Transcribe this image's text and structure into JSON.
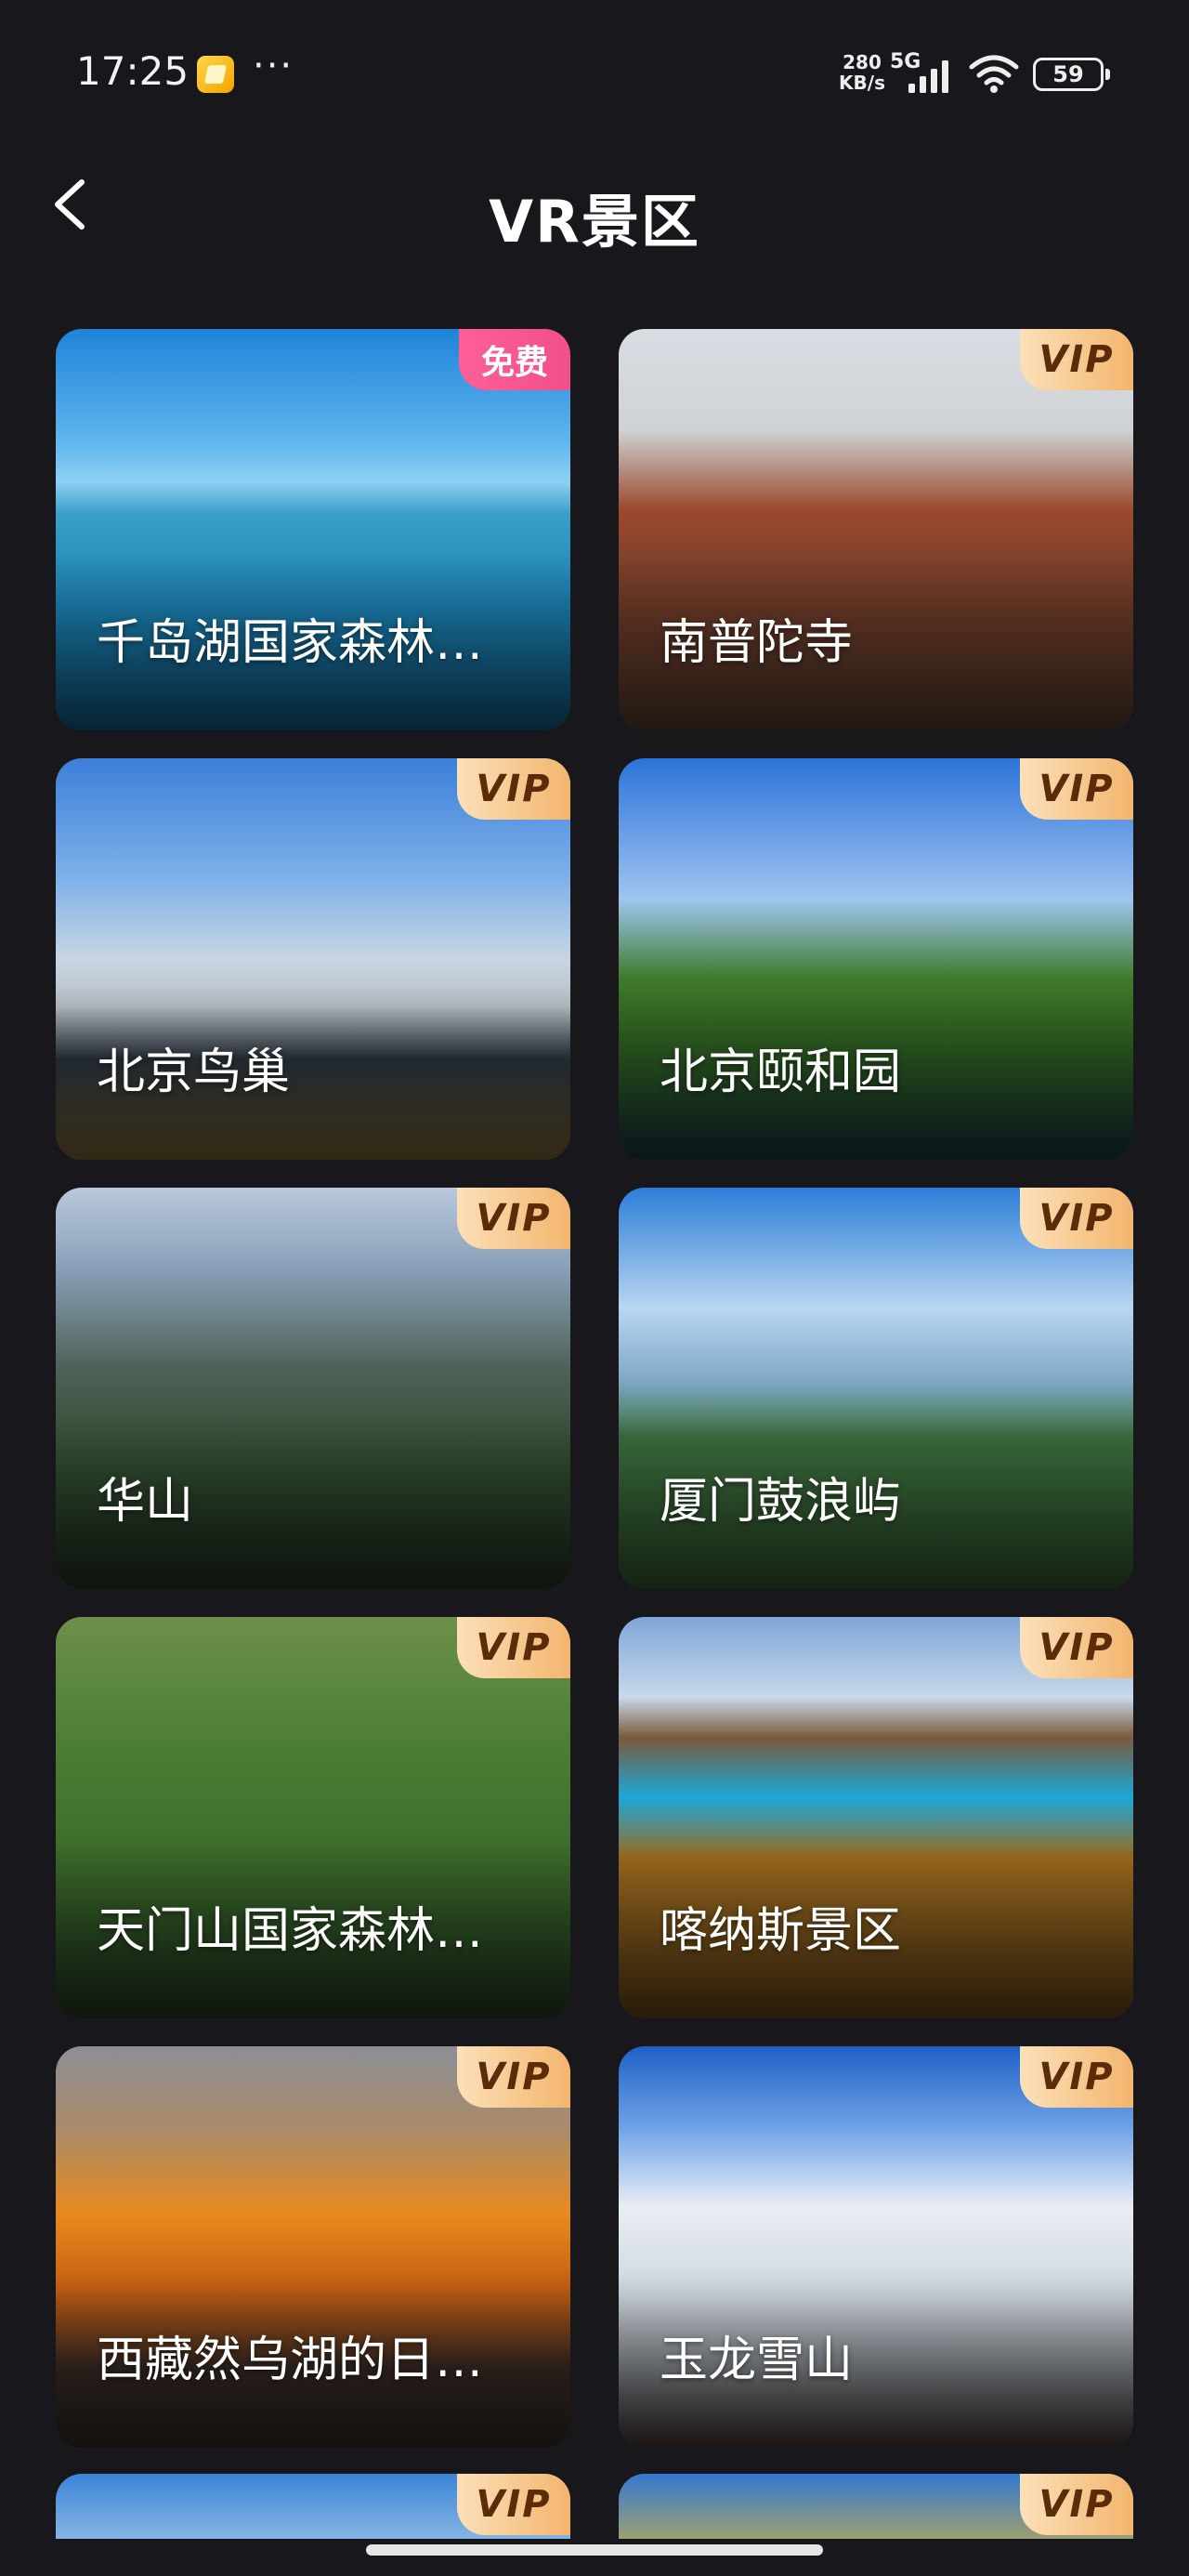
{
  "status_bar": {
    "time": "17:25",
    "more": "···",
    "net_speed_value": "280",
    "net_speed_unit": "KB/s",
    "network": "5G",
    "battery": "59"
  },
  "header": {
    "title": "VR景区",
    "back_icon": "chevron-left-icon"
  },
  "cards": [
    {
      "title": "千岛湖国家森林…",
      "badge": "免费",
      "badge_type": "free"
    },
    {
      "title": "南普陀寺",
      "badge": "VIP",
      "badge_type": "vip"
    },
    {
      "title": "北京鸟巢",
      "badge": "VIP",
      "badge_type": "vip"
    },
    {
      "title": "北京颐和园",
      "badge": "VIP",
      "badge_type": "vip"
    },
    {
      "title": "华山",
      "badge": "VIP",
      "badge_type": "vip"
    },
    {
      "title": "厦门鼓浪屿",
      "badge": "VIP",
      "badge_type": "vip"
    },
    {
      "title": "天门山国家森林…",
      "badge": "VIP",
      "badge_type": "vip"
    },
    {
      "title": "喀纳斯景区",
      "badge": "VIP",
      "badge_type": "vip"
    },
    {
      "title": "西藏然乌湖的日…",
      "badge": "VIP",
      "badge_type": "vip"
    },
    {
      "title": "玉龙雪山",
      "badge": "VIP",
      "badge_type": "vip"
    }
  ],
  "partial_cards": [
    {
      "badge": "VIP"
    },
    {
      "badge": "VIP"
    }
  ],
  "colors": {
    "background": "#17171c",
    "vip_badge": "#f3b56e",
    "free_badge": "#f04f8c"
  }
}
